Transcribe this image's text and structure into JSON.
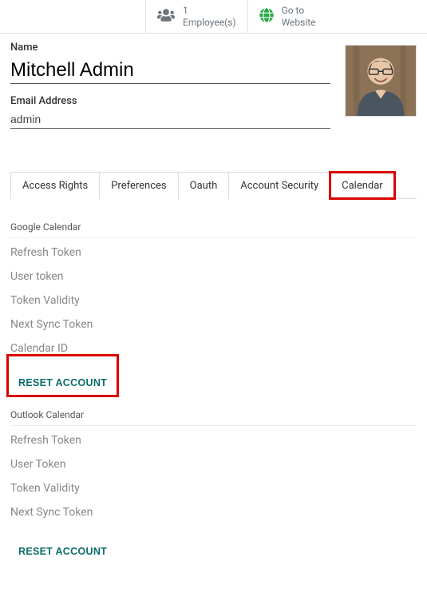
{
  "topbar": {
    "employees": {
      "count": "1",
      "label": "Employee(s)"
    },
    "website": {
      "line1": "Go to",
      "line2": "Website"
    }
  },
  "form": {
    "name_label": "Name",
    "name_value": "Mitchell Admin",
    "email_label": "Email Address",
    "email_value": "admin"
  },
  "tabs": [
    {
      "label": "Access Rights"
    },
    {
      "label": "Preferences"
    },
    {
      "label": "Oauth"
    },
    {
      "label": "Account Security"
    },
    {
      "label": "Calendar",
      "active": true
    }
  ],
  "google_section": {
    "title": "Google Calendar",
    "rows": [
      "Refresh Token",
      "User token",
      "Token Validity",
      "Next Sync Token",
      "Calendar ID"
    ],
    "reset": "RESET ACCOUNT"
  },
  "outlook_section": {
    "title": "Outlook Calendar",
    "rows": [
      "Refresh Token",
      "User Token",
      "Token Validity",
      "Next Sync Token"
    ],
    "reset": "RESET ACCOUNT"
  }
}
